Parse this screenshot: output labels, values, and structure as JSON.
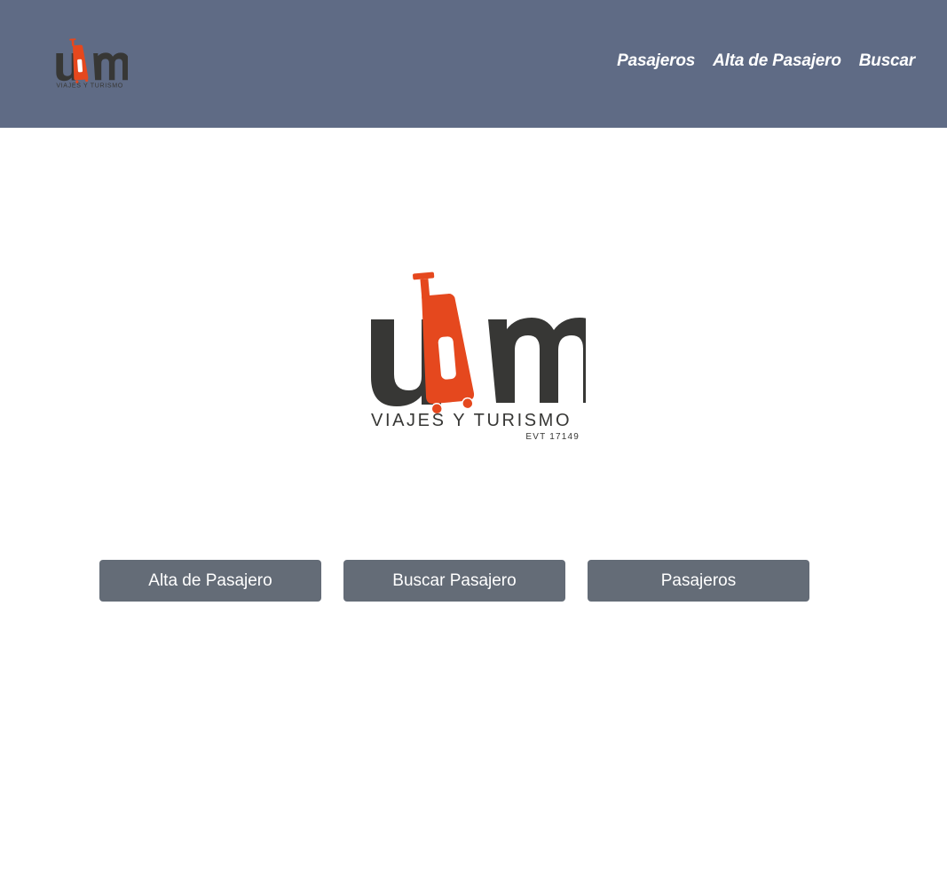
{
  "brand": {
    "logo_text": "ubm",
    "tagline": "VIAJES Y TURISMO",
    "license": "EVT 17149",
    "colors": {
      "dark": "#373735",
      "accent": "#e5481e",
      "header_bg": "#5f6b85",
      "button_bg": "#646c77"
    }
  },
  "nav": {
    "items": [
      {
        "label": "Pasajeros"
      },
      {
        "label": "Alta de Pasajero"
      },
      {
        "label": "Buscar"
      }
    ]
  },
  "actions": {
    "buttons": [
      {
        "label": "Alta de Pasajero"
      },
      {
        "label": "Buscar Pasajero"
      },
      {
        "label": "Pasajeros"
      }
    ]
  }
}
